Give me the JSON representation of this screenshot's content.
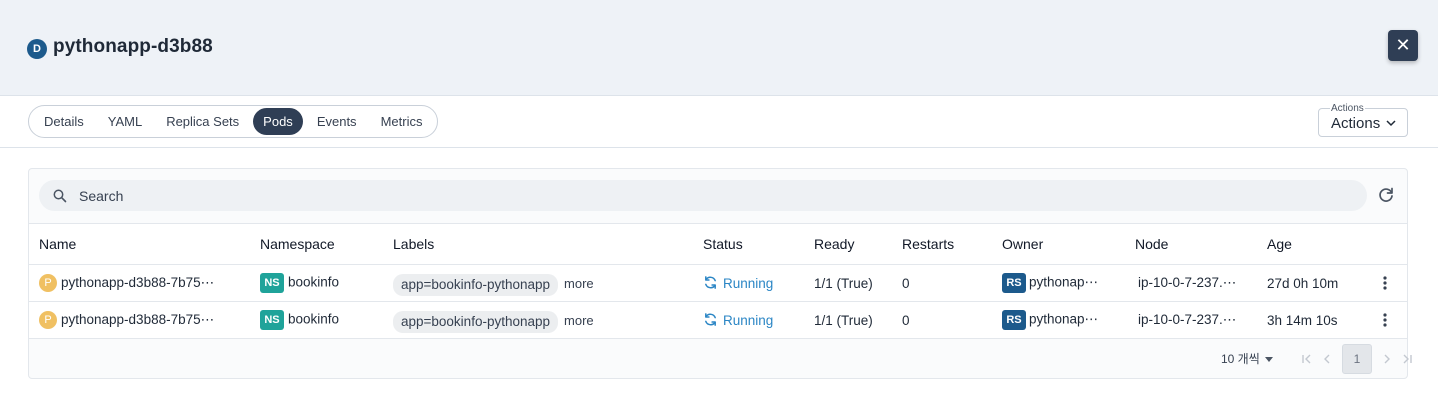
{
  "header": {
    "kind_badge": "D",
    "title": "pythonapp-d3b88",
    "close_icon": "close-icon"
  },
  "tabs": [
    {
      "label": "Details",
      "active": false
    },
    {
      "label": "YAML",
      "active": false
    },
    {
      "label": "Replica Sets",
      "active": false
    },
    {
      "label": "Pods",
      "active": true
    },
    {
      "label": "Events",
      "active": false
    },
    {
      "label": "Metrics",
      "active": false
    }
  ],
  "actions": {
    "float_label": "Actions",
    "label": "Actions",
    "icon": "chevron-down-icon"
  },
  "search": {
    "placeholder": "Search",
    "value": "",
    "icon": "search-icon",
    "refresh_icon": "refresh-icon"
  },
  "table": {
    "columns": [
      "Name",
      "Namespace",
      "Labels",
      "Status",
      "Ready",
      "Restarts",
      "Owner",
      "Node",
      "Age"
    ],
    "rows": [
      {
        "name_badge": "P",
        "name": "pythonapp-d3b88-7b75⋯",
        "ns_badge": "NS",
        "namespace": "bookinfo",
        "label": "app=bookinfo-pythonapp",
        "more": "more",
        "status": "Running",
        "ready": "1/1 (True)",
        "restarts": "0",
        "owner_badge": "RS",
        "owner": "pythonap⋯",
        "node": "ip-10-0-7-237.⋯",
        "age": "27d 0h 10m"
      },
      {
        "name_badge": "P",
        "name": "pythonapp-d3b88-7b75⋯",
        "ns_badge": "NS",
        "namespace": "bookinfo",
        "label": "app=bookinfo-pythonapp",
        "more": "more",
        "status": "Running",
        "ready": "1/1 (True)",
        "restarts": "0",
        "owner_badge": "RS",
        "owner": "pythonap⋯",
        "node": "ip-10-0-7-237.⋯",
        "age": "3h 14m 10s"
      }
    ]
  },
  "pagination": {
    "page_size": "10 개씩",
    "current_page": "1"
  },
  "colors": {
    "accent_dark": "#2f3e55",
    "deployment_badge": "#1c5a8c",
    "namespace_badge": "#1fa39a",
    "pod_badge": "#f0c062",
    "status_running": "#2b86c5"
  }
}
